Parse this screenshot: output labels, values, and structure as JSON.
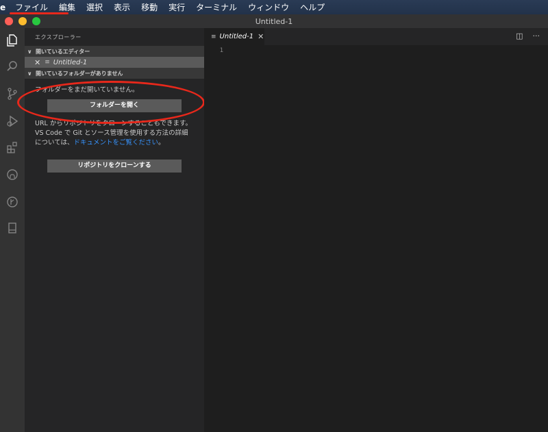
{
  "menubar": {
    "app_fragment": "e",
    "items": [
      "ファイル",
      "編集",
      "選択",
      "表示",
      "移動",
      "実行",
      "ターミナル",
      "ウィンドウ",
      "ヘルプ"
    ]
  },
  "window": {
    "title": "Untitled-1"
  },
  "sidebar": {
    "title": "エクスプローラー",
    "open_editors_header": "開いているエディター",
    "open_editor_item": "Untitled-1",
    "no_folder_header": "開いているフォルダーがありません",
    "no_folder_message": "フォルダーをまだ開いていません。",
    "open_folder_button": "フォルダーを開く",
    "clone_text_1": "URL からリポジトリをクローンすることもできます。",
    "clone_text_2": "VS Code で Git とソース管理を使用する方法の詳細については、",
    "docs_link": "ドキュメントをご覧ください",
    "docs_suffix": "。",
    "clone_button": "リポジトリをクローンする"
  },
  "editor": {
    "tab_label": "Untitled-1",
    "line_number": "1"
  },
  "colors": {
    "accent_annotation": "#e8281b",
    "link": "#3794ff"
  },
  "icons": {
    "activity": [
      "files-icon",
      "search-icon",
      "source-control-icon",
      "run-debug-icon",
      "extensions-icon",
      "github-icon",
      "git-graph-icon",
      "book-icon"
    ]
  }
}
